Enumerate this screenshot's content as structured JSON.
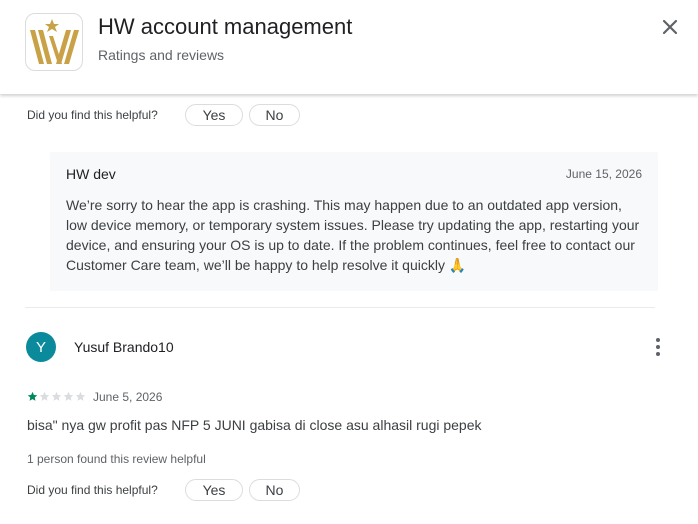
{
  "header": {
    "app_name": "HW account management",
    "subtitle": "Ratings and reviews",
    "icon": "hw-logo-icon",
    "close_icon": "close-icon"
  },
  "prev_review": {
    "helpful_question": "Did you find this helpful?",
    "yes_label": "Yes",
    "no_label": "No"
  },
  "dev_reply": {
    "author": "HW dev",
    "date": "June 15, 2026",
    "text": "We’re sorry to hear the app is crashing. This may happen due to an outdated app version, low device memory, or temporary system issues. Please try updating the app, restarting your device, and ensuring your OS is up to date. If the problem continues, feel free to contact our Customer Care team, we’ll be happy to help resolve it quickly 🙏"
  },
  "review": {
    "avatar_letter": "Y",
    "avatar_color": "#0b8a9c",
    "author": "Yusuf Brando10",
    "rating": 1,
    "max_rating": 5,
    "date": "June 5, 2026",
    "text": "bisa\" nya gw profit pas NFP 5 JUNI gabisa di close asu alhasil rugi pepek",
    "helpful_count_text": "1 person found this review helpful",
    "helpful_question": "Did you find this helpful?",
    "yes_label": "Yes",
    "no_label": "No",
    "more_icon": "more-vert-icon"
  },
  "colors": {
    "star_filled": "#01875f",
    "star_empty": "#dadce0",
    "logo_gold": "#c9a247"
  }
}
